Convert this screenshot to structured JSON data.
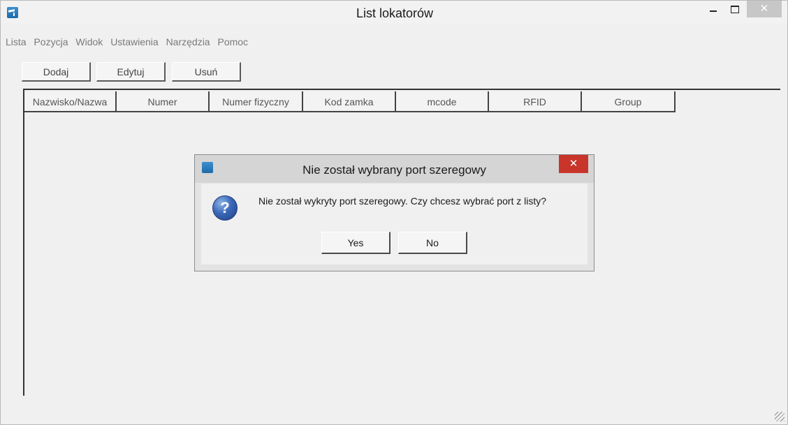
{
  "window": {
    "title": "List lokatorów"
  },
  "menu": [
    "Lista",
    "Pozycja",
    "Widok",
    "Ustawienia",
    "Narzędzia",
    "Pomoc"
  ],
  "toolbar": {
    "add": "Dodaj",
    "edit": "Edytuj",
    "delete": "Usuń"
  },
  "table": {
    "columns": [
      "Nazwisko/Nazwa",
      "Numer",
      "Numer fizyczny",
      "Kod zamka",
      "mcode",
      "RFID",
      "Group"
    ]
  },
  "dialog": {
    "title": "Nie został wybrany port szeregowy",
    "message": "Nie został wykryty port szeregowy. Czy chcesz wybrać port z listy?",
    "yes": "Yes",
    "no": "No",
    "icon": "question-icon"
  },
  "colors": {
    "dialog_close": "#c9342b",
    "accent_icon": "#1d6aa8"
  }
}
